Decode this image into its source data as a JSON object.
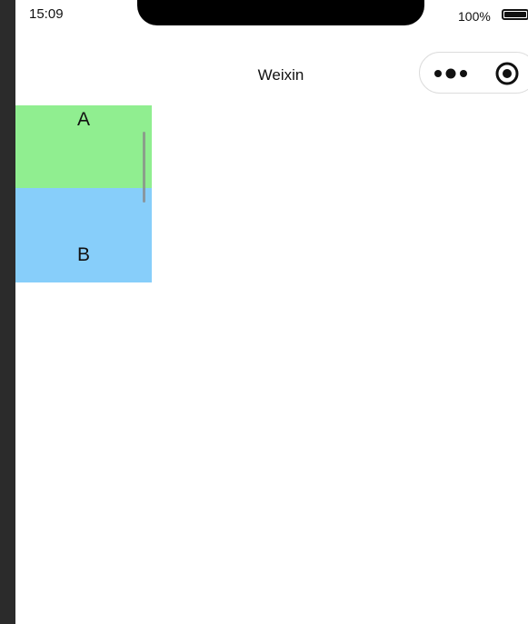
{
  "status_bar": {
    "time": "15:09",
    "battery_percent": "100%",
    "battery_level": 1.0
  },
  "nav_bar": {
    "title": "Weixin",
    "capsule": {
      "more_icon": "more-dots-icon",
      "close_icon": "target-circle-icon"
    }
  },
  "scroll_view": {
    "items": [
      {
        "label": "A",
        "color": "#90ee90"
      },
      {
        "label": "B",
        "color": "#87cefa"
      }
    ]
  }
}
